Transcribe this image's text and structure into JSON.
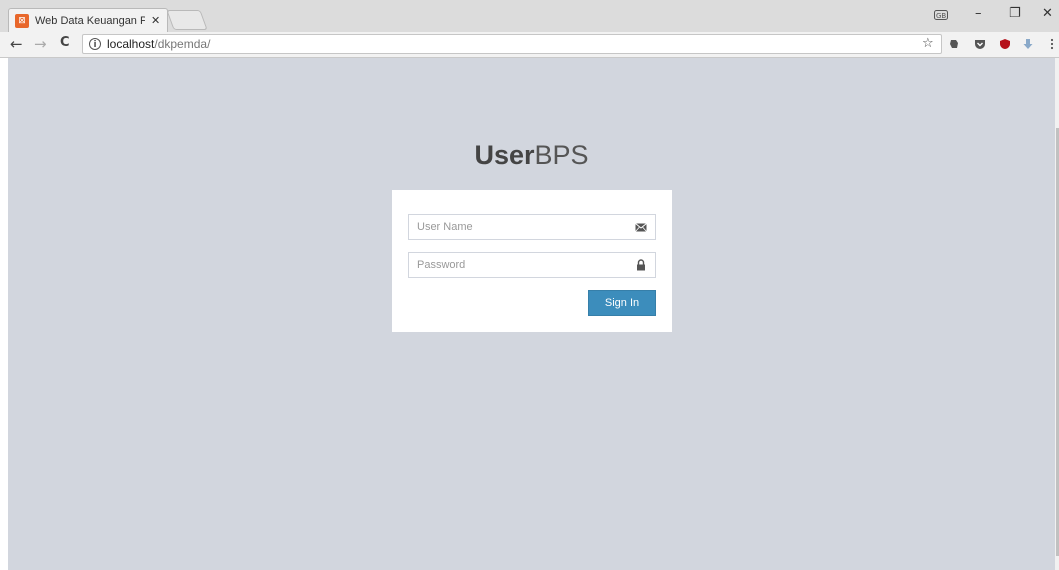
{
  "browser": {
    "tab_title": "Web Data Keuangan Pem",
    "tab_close": "✕",
    "url_host": "localhost",
    "url_path": "/dkpemda/",
    "window_controls": {
      "minimize": "–",
      "restore": "❐",
      "close": "✕"
    },
    "nav": {
      "back": "←",
      "forward": "→",
      "reload": "C"
    },
    "star": "☆"
  },
  "login": {
    "logo_bold": "User",
    "logo_light": "BPS",
    "username_placeholder": "User Name",
    "password_placeholder": "Password",
    "signin_label": "Sign In"
  },
  "colors": {
    "page_bg": "#d2d6de",
    "box_bg": "#ffffff",
    "button": "#3c8dbc",
    "favicon": "#e8672b"
  },
  "icons": {
    "username_field": "envelope-icon",
    "password_field": "lock-icon"
  }
}
